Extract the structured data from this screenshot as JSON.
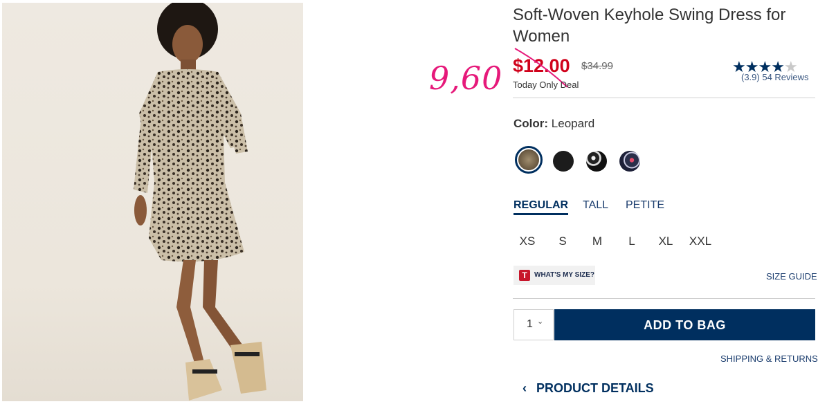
{
  "product": {
    "title": "Soft-Woven Keyhole Swing Dress for Women",
    "sale_price": "$12.00",
    "original_price": "$34.99",
    "deal_label": "Today Only Deal",
    "handwritten_note": "9,60",
    "rating_stars": 4,
    "rating_max": 5,
    "reviews_text": "(3.9) 54 Reviews"
  },
  "color": {
    "label": "Color:",
    "value": "Leopard",
    "swatches": [
      {
        "name": "leopard",
        "color": "#8a7a60",
        "selected": true
      },
      {
        "name": "black",
        "color": "#1c1c1c",
        "selected": false
      },
      {
        "name": "black-white-floral",
        "color": "#3a3a3a",
        "selected": false
      },
      {
        "name": "navy-floral",
        "color": "#2a2f4a",
        "selected": false
      }
    ]
  },
  "fit_tabs": [
    "REGULAR",
    "TALL",
    "PETITE"
  ],
  "sizes": [
    "XS",
    "S",
    "M",
    "L",
    "XL",
    "XXL"
  ],
  "fit_helper": {
    "icon_letter": "T",
    "label": "WHAT'S MY SIZE?"
  },
  "size_guide_label": "SIZE GUIDE",
  "quantity": {
    "value": "1"
  },
  "add_to_bag_label": "ADD TO BAG",
  "shipping_label": "SHIPPING & RETURNS",
  "product_details_label": "PRODUCT DETAILS",
  "colors": {
    "brand_navy": "#002f5f",
    "sale_red": "#d0021b",
    "annotation_pink": "#e6197a"
  }
}
